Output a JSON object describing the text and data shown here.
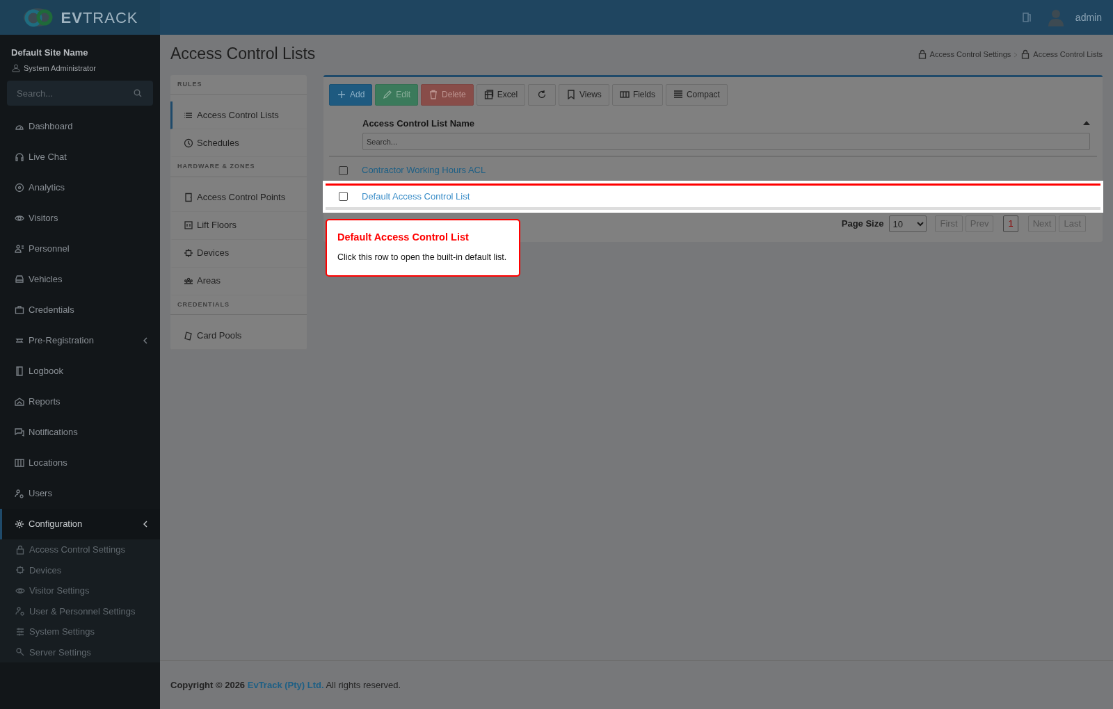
{
  "header": {
    "logo": "**EV**TRACK",
    "user": "admin"
  },
  "sidebar": {
    "site_name": "Default Site Name",
    "role": "System Administrator",
    "search": {
      "placeholder": "Search..."
    },
    "items": [
      {
        "label": "Dashboard",
        "selected": false
      },
      {
        "label": "Live Chat",
        "selected": false
      },
      {
        "label": "Analytics",
        "selected": false
      },
      {
        "label": "Visitors",
        "selected": false
      },
      {
        "label": "Personnel",
        "selected": false
      },
      {
        "label": "Vehicles",
        "selected": false
      },
      {
        "label": "Credentials",
        "selected": false
      },
      {
        "label": "Pre-Registration",
        "selected": false,
        "expandable": true
      },
      {
        "label": "Logbook",
        "selected": false
      },
      {
        "label": "Reports",
        "selected": false
      },
      {
        "label": "Notifications",
        "selected": false
      },
      {
        "label": "Locations",
        "selected": false
      },
      {
        "label": "Users",
        "selected": false
      },
      {
        "label": "Configuration",
        "selected": true,
        "expandable": true,
        "children": [
          {
            "label": "Access Control Settings",
            "selected": false
          },
          {
            "label": "Devices",
            "selected": false
          },
          {
            "label": "Visitor Settings",
            "selected": false
          },
          {
            "label": "User & Personnel Settings",
            "selected": false
          },
          {
            "label": "System Settings",
            "selected": false
          },
          {
            "label": "Server Settings",
            "selected": false
          }
        ]
      }
    ]
  },
  "page": {
    "title": "Access Control Lists",
    "breadcrumb": [
      "Access Control Settings",
      "Access Control Lists"
    ]
  },
  "subnav": [
    {
      "heading": "RULES",
      "items": [
        {
          "label": "Access Control Lists",
          "selected": true
        },
        {
          "label": "Schedules",
          "selected": false
        }
      ]
    },
    {
      "heading": "HARDWARE & ZONES",
      "items": [
        {
          "label": "Access Control Points",
          "selected": false
        },
        {
          "label": "Lift Floors",
          "selected": false
        },
        {
          "label": "Devices",
          "selected": false
        },
        {
          "label": "Areas",
          "selected": false
        }
      ]
    },
    {
      "heading": "CREDENTIALS",
      "items": [
        {
          "label": "Card Pools",
          "selected": false
        }
      ]
    }
  ],
  "toolbar": [
    {
      "kind": "add",
      "label": "Add",
      "disabled": false
    },
    {
      "kind": "edit",
      "label": "Edit",
      "disabled": true
    },
    {
      "kind": "delete",
      "label": "Delete",
      "disabled": true
    },
    {
      "kind": "excel",
      "label": "Excel",
      "disabled": false
    },
    {
      "kind": "refresh",
      "disabled": false
    },
    {
      "kind": "views",
      "label": "Views",
      "disabled": false
    },
    {
      "kind": "fields",
      "label": "Fields",
      "disabled": false
    },
    {
      "kind": "compact",
      "label": "Compact",
      "disabled": false
    }
  ],
  "table": {
    "column": "Access Control List Name",
    "sort_ascending": true,
    "filter": {
      "placeholder": "Search..."
    },
    "rows": [
      {
        "name": "Contractor Working Hours ACL",
        "checked": false,
        "highlighted": false
      },
      {
        "name": "Default Access Control List",
        "checked": false,
        "highlighted": true
      }
    ]
  },
  "pager": {
    "page_size_label": "Page Size",
    "page_size": "10",
    "buttons": [
      {
        "label": "First",
        "disabled": true,
        "selected": false
      },
      {
        "label": "Prev",
        "disabled": true,
        "selected": false
      },
      {
        "label": "1",
        "disabled": false,
        "selected": true
      },
      {
        "label": "Next",
        "disabled": true,
        "selected": false
      },
      {
        "label": "Last",
        "disabled": true,
        "selected": false
      }
    ]
  },
  "tour": {
    "title": "Default Access Control List",
    "text": "Click this row to open the built-in default list."
  },
  "footer": {
    "copyright": "**Copyright © 2026** ",
    "company": "EvTrack (Pty) Ltd.",
    "rest": " All rights reserved."
  }
}
